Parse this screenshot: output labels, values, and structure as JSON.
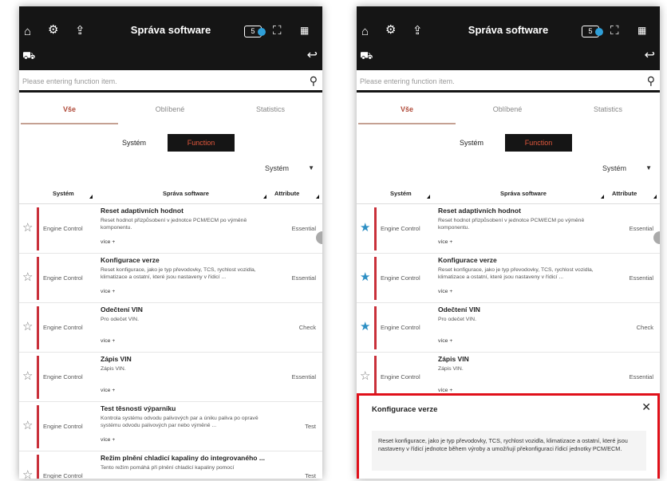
{
  "app": {
    "title": "Správa software",
    "badge_text": "5"
  },
  "icons": {
    "home": "home-icon",
    "gear": "gear-icon",
    "export": "export-icon",
    "focus": "focus-icon",
    "grid": "grid-icon",
    "car": "vehicle-icon",
    "back": "back-arrow-icon",
    "search": "search-icon",
    "star": "star-icon",
    "close": "close-icon"
  },
  "colors": {
    "accent": "#e3583c",
    "row_bar": "#c9303a",
    "star_active": "#2d8fc4",
    "popup_border": "#e0101a"
  },
  "search": {
    "placeholder": "Please entering function item."
  },
  "tabs": [
    {
      "label": "Vše",
      "active": true
    },
    {
      "label": "Oblíbené",
      "active": false
    },
    {
      "label": "Statistics",
      "active": false
    }
  ],
  "toggle": {
    "left": "Systém",
    "right": "Function"
  },
  "dropdown": {
    "value": "Systém",
    "arrow": "▼"
  },
  "table": {
    "headers": [
      "Systém",
      "Správa software",
      "Attribute"
    ]
  },
  "left_rows": [
    {
      "system": "Engine Control",
      "name": "Reset adaptivních hodnot",
      "desc": "Reset hodnot přizpůsobení v jednotce PCM/ECM po výměně komponentu.",
      "more": "více +",
      "attr": "Essential",
      "fav": false
    },
    {
      "system": "Engine Control",
      "name": "Konfigurace verze",
      "desc": "Reset konfigurace, jako je typ převodovky, TCS, rychlost vozidla, klimatizace a ostatní, které jsou nastaveny v řídicí ...",
      "more": "více +",
      "attr": "Essential",
      "fav": false
    },
    {
      "system": "Engine Control",
      "name": "Odečtení VIN",
      "desc": "Pro odečet VIN.",
      "more": "více +",
      "attr": "Check",
      "fav": false
    },
    {
      "system": "Engine Control",
      "name": "Zápis VIN",
      "desc": "Zápis VIN.",
      "more": "více +",
      "attr": "Essential",
      "fav": false
    },
    {
      "system": "Engine Control",
      "name": "Test těsnosti výparníku",
      "desc": "Kontrola systému odvodu palivových par a úniku paliva po opravě systému odvodu palivových par nebo výměně ...",
      "more": "více +",
      "attr": "Test",
      "fav": false
    },
    {
      "system": "Engine Control",
      "name": "Režim plnění chladicí kapaliny do integrovaného ...",
      "desc": "Tento režim pomáhá při plnění chladicí kapaliny pomocí",
      "more": "více +",
      "attr": "Test",
      "fav": false
    }
  ],
  "right_rows": [
    {
      "system": "Engine Control",
      "name": "Reset adaptivních hodnot",
      "desc": "Reset hodnot přizpůsobení v jednotce PCM/ECM po výměně komponentu.",
      "more": "více +",
      "attr": "Essential",
      "fav": true
    },
    {
      "system": "Engine Control",
      "name": "Konfigurace verze",
      "desc": "Reset konfigurace, jako je typ převodovky, TCS, rychlost vozidla, klimatizace a ostatní, které jsou nastaveny v řídicí ...",
      "more": "více +",
      "attr": "Essential",
      "fav": true
    },
    {
      "system": "Engine Control",
      "name": "Odečtení VIN",
      "desc": "Pro odečet VIN.",
      "more": "více +",
      "attr": "Check",
      "fav": true
    },
    {
      "system": "Engine Control",
      "name": "Zápis VIN",
      "desc": "Zápis VIN.",
      "more": "více +",
      "attr": "Essential",
      "fav": false
    }
  ],
  "popup": {
    "title": "Konfigurace verze",
    "close": "✕",
    "body": "Reset konfigurace, jako je typ převodovky, TCS, rychlost vozidla, klimatizace a ostatní, které jsou nastaveny v řídicí jednotce během výroby a umožňují překonfiguraci řídicí jednotky PCM/ECM."
  }
}
